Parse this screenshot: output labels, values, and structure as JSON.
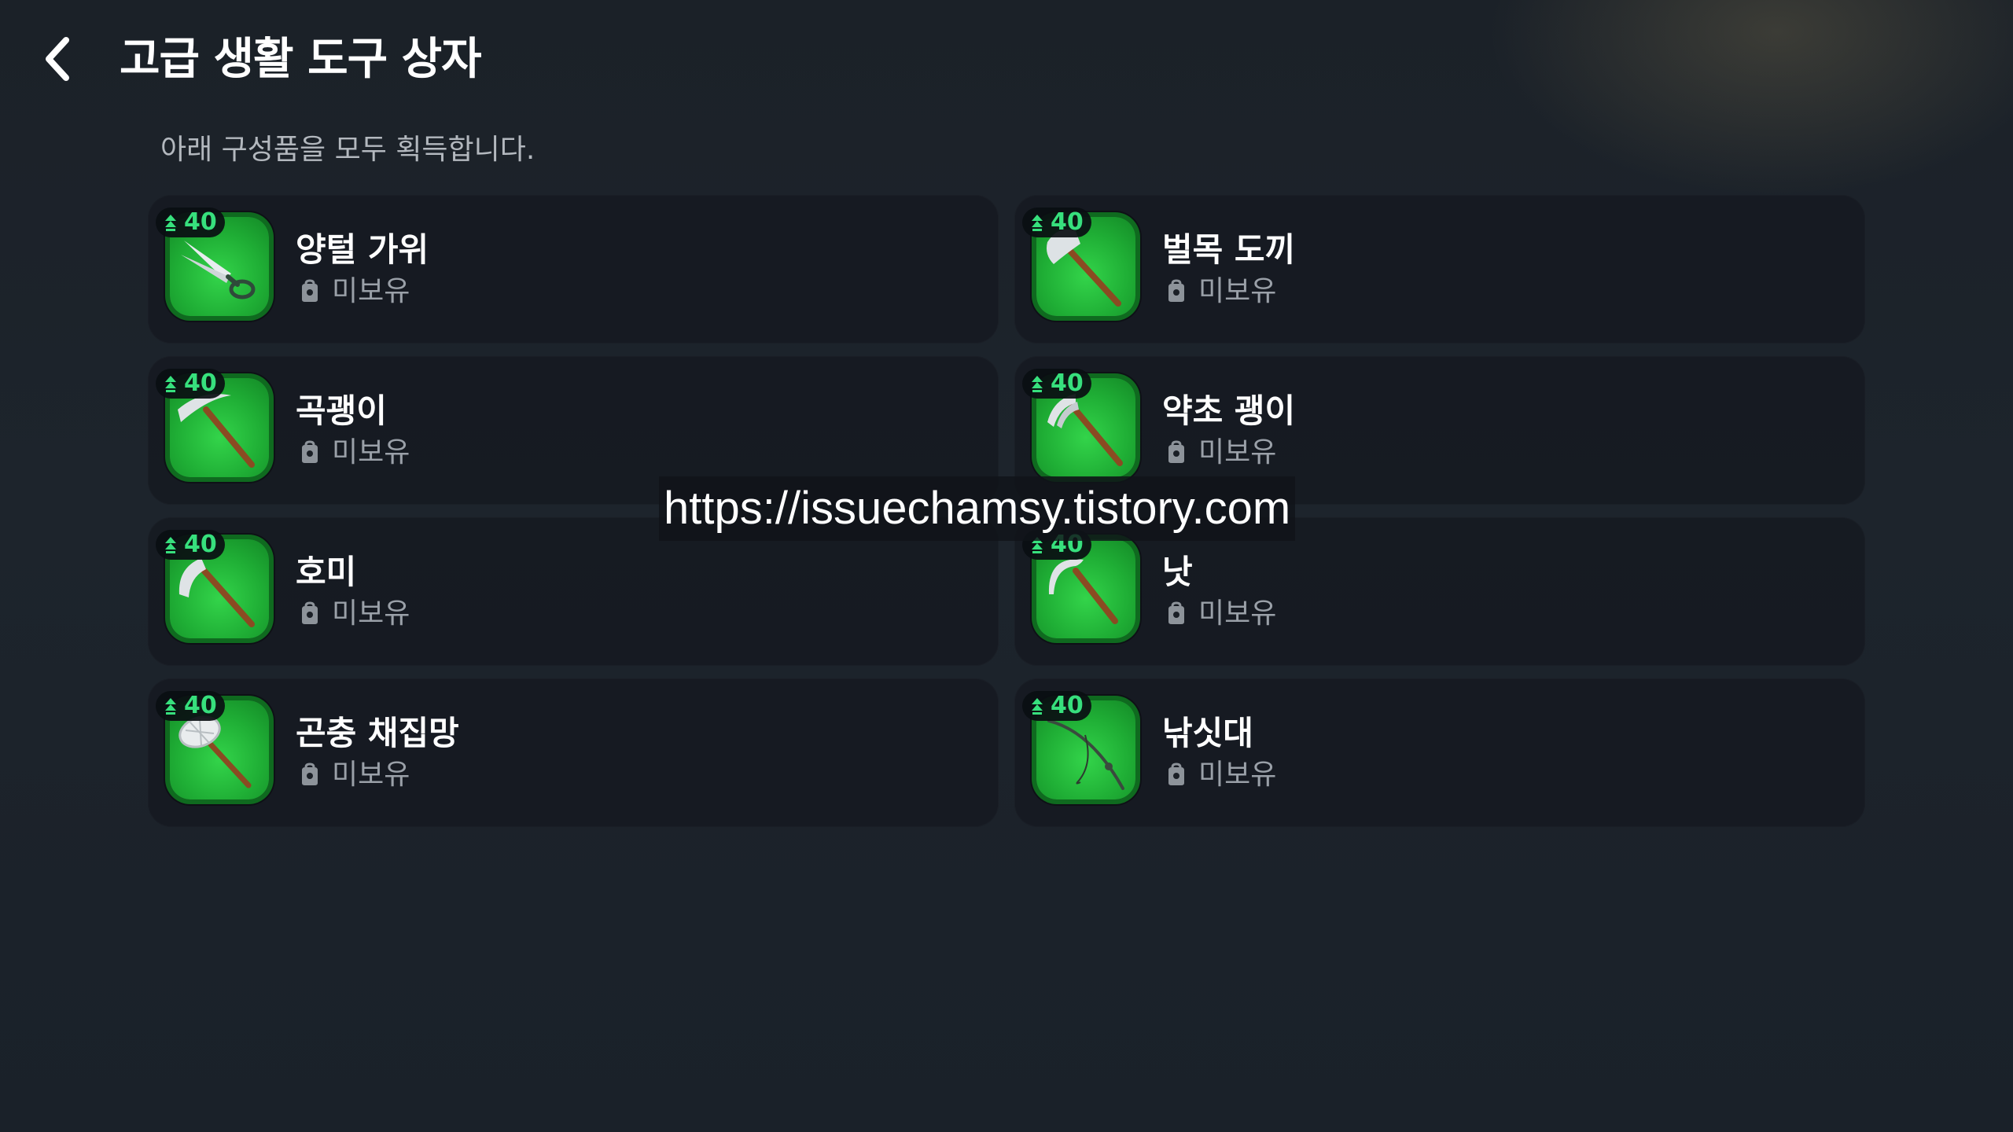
{
  "header": {
    "title": "고급 생활 도구 상자",
    "back_icon": "chevron-left-icon"
  },
  "subtitle": "아래 구성품을 모두 획득합니다.",
  "items": [
    {
      "name": "양털 가위",
      "level": "40",
      "status": "미보유",
      "icon": "shears-icon"
    },
    {
      "name": "벌목 도끼",
      "level": "40",
      "status": "미보유",
      "icon": "axe-icon"
    },
    {
      "name": "곡괭이",
      "level": "40",
      "status": "미보유",
      "icon": "pickaxe-icon"
    },
    {
      "name": "약초 괭이",
      "level": "40",
      "status": "미보유",
      "icon": "herb-hoe-icon"
    },
    {
      "name": "호미",
      "level": "40",
      "status": "미보유",
      "icon": "hoe-icon"
    },
    {
      "name": "낫",
      "level": "40",
      "status": "미보유",
      "icon": "sickle-icon"
    },
    {
      "name": "곤충 채집망",
      "level": "40",
      "status": "미보유",
      "icon": "bug-net-icon"
    },
    {
      "name": "낚싯대",
      "level": "40",
      "status": "미보유",
      "icon": "fishing-rod-icon"
    }
  ],
  "watermark": "https://issuechamsy.tistory.com",
  "colors": {
    "background": "#1c232b",
    "card": "#141820",
    "icon_green": "#22b83a",
    "level_green": "#37e07d",
    "status_gray": "#9aa0a8"
  }
}
